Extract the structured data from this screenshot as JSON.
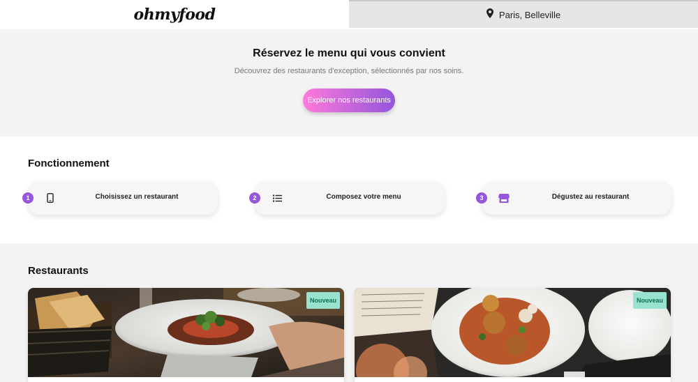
{
  "header": {
    "logo": "ohmyfood",
    "location": "Paris, Belleville",
    "location_icon": "map-pin-icon"
  },
  "hero": {
    "title": "Réservez le menu qui vous convient",
    "subtitle": "Découvrez des restaurants d'exception, sélectionnés par nos soins.",
    "cta": "Explorer nos restaurants"
  },
  "how": {
    "title": "Fonctionnement",
    "steps": [
      {
        "number": "1",
        "icon": "smartphone-icon",
        "label": "Choisissez un restaurant"
      },
      {
        "number": "2",
        "icon": "list-icon",
        "label": "Composez votre menu"
      },
      {
        "number": "3",
        "icon": "store-icon",
        "label": "Dégustez au restaurant"
      }
    ]
  },
  "restaurants": {
    "title": "Restaurants",
    "cards": [
      {
        "badge": "Nouveau",
        "image": "plated-dish-photo"
      },
      {
        "badge": "Nouveau",
        "image": "meatballs-dish-photo"
      }
    ]
  },
  "colors": {
    "primary": "#9356dc",
    "gradient_start": "#ff79da",
    "badge_bg": "#99e2d0",
    "badge_text": "#0b6e56",
    "section_bg": "#f3f3f3"
  }
}
